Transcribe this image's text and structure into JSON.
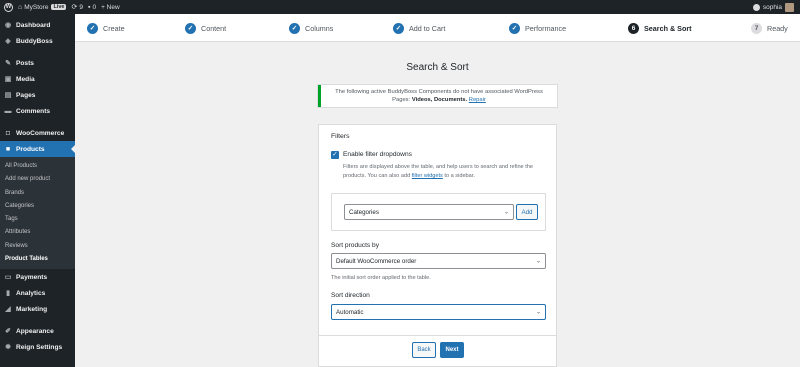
{
  "admin_bar": {
    "site_name": "MyStore",
    "live_badge": "Live",
    "updates_count": "9",
    "comments_count": "0",
    "new_label": "+ New",
    "user_name": "sophia"
  },
  "sidebar": {
    "items": [
      {
        "label": "Dashboard",
        "icon": "dashboard-icon"
      },
      {
        "label": "BuddyBoss",
        "icon": "buddyboss-icon"
      },
      {
        "label": "Posts",
        "icon": "pin-icon"
      },
      {
        "label": "Media",
        "icon": "media-icon"
      },
      {
        "label": "Pages",
        "icon": "pages-icon"
      },
      {
        "label": "Comments",
        "icon": "comments-icon"
      },
      {
        "label": "WooCommerce",
        "icon": "woocommerce-icon"
      },
      {
        "label": "Products",
        "icon": "products-icon"
      },
      {
        "label": "Payments",
        "icon": "payments-icon"
      },
      {
        "label": "Analytics",
        "icon": "analytics-icon"
      },
      {
        "label": "Marketing",
        "icon": "marketing-icon"
      },
      {
        "label": "Appearance",
        "icon": "appearance-icon"
      },
      {
        "label": "Reign Settings",
        "icon": "gear-icon"
      }
    ],
    "submenu": [
      "All Products",
      "Add new product",
      "Brands",
      "Categories",
      "Tags",
      "Attributes",
      "Reviews",
      "Product Tables"
    ]
  },
  "steps": [
    {
      "label": "Create",
      "marker": "✓"
    },
    {
      "label": "Content",
      "marker": "✓"
    },
    {
      "label": "Columns",
      "marker": "✓"
    },
    {
      "label": "Add to Cart",
      "marker": "✓"
    },
    {
      "label": "Performance",
      "marker": "✓"
    },
    {
      "label": "Search & Sort",
      "marker": "6"
    },
    {
      "label": "Ready",
      "marker": "7"
    }
  ],
  "page": {
    "title": "Search & Sort",
    "notice_text": "The following active BuddyBoss Components do not have associated WordPress Pages:",
    "notice_pages": "Videos, Documents.",
    "notice_link": "Repair"
  },
  "filters": {
    "heading": "Filters",
    "checkbox_label": "Enable filter dropdowns",
    "help_text": "Filters are displayed above the table, and help users to search and refine the products. You can also add",
    "help_link": "filter widgets",
    "help_suffix": "to a sidebar.",
    "filter_select": "Categories",
    "add_button": "Add"
  },
  "sort_by": {
    "label": "Sort products by",
    "value": "Default WooCommerce order",
    "help": "The initial sort order applied to the table."
  },
  "sort_direction": {
    "label": "Sort direction",
    "value": "Automatic"
  },
  "footer": {
    "back_label": "Back",
    "next_label": "Next"
  },
  "colors": {
    "accent": "#2271b1",
    "sidebar_bg": "#1d2327",
    "notice_border": "#00a32a"
  }
}
